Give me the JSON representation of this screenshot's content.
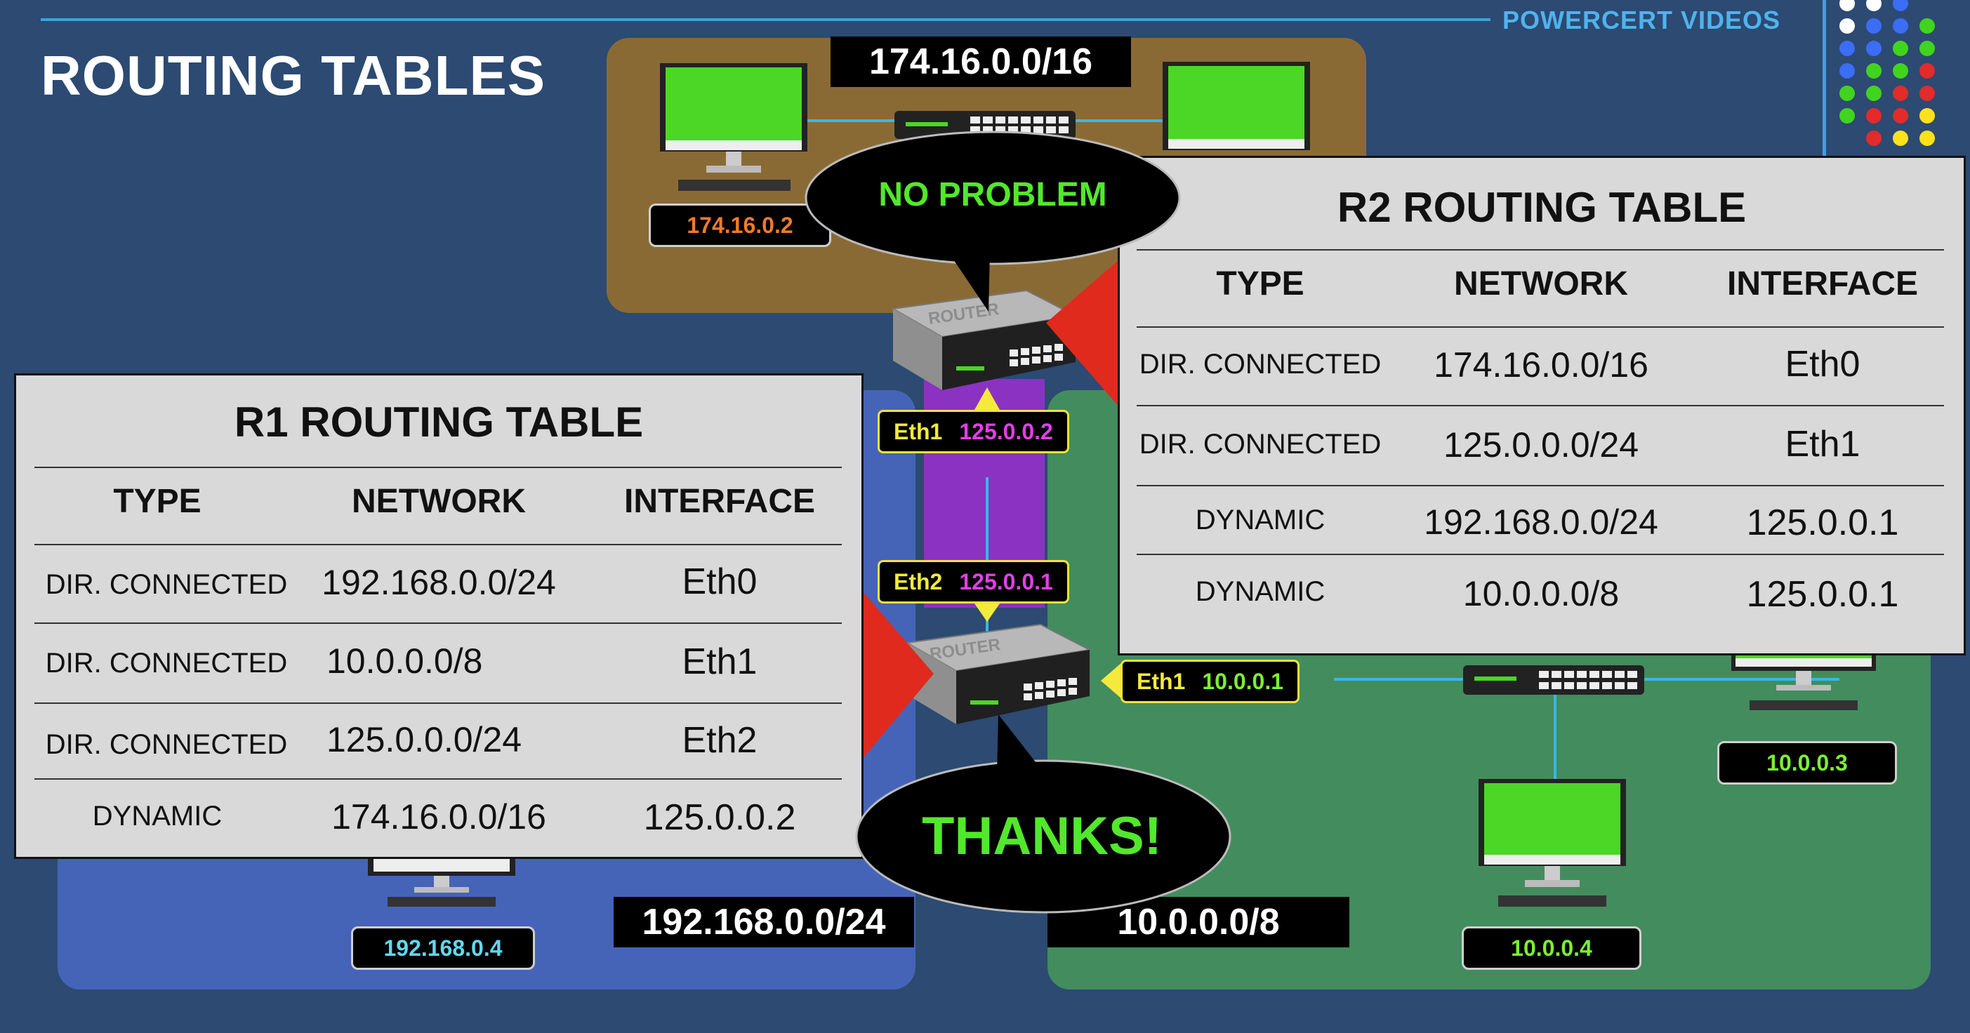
{
  "header": {
    "title": "ROUTING TABLES",
    "brand": "POWERCERT VIDEOS",
    "dot_colors": [
      "#ffffff",
      "#3b6df5",
      "#41d41f",
      "#e22b2b",
      "#ffe21c"
    ]
  },
  "networks": {
    "top": "174.16.0.0/16",
    "left": "192.168.0.0/24",
    "right": "10.0.0.0/8"
  },
  "hosts": {
    "top_host": "174.16.0.2",
    "left_host": "192.168.0.4",
    "right_host_a": "10.0.0.3",
    "right_host_b": "10.0.0.4"
  },
  "routers": {
    "r2_label": "ROUTER",
    "r1_label": "ROUTER",
    "r2_eth1_name": "Eth1",
    "r2_eth1_ip": "125.0.0.2",
    "r1_eth2_name": "Eth2",
    "r1_eth2_ip": "125.0.0.1",
    "r1_eth1_name": "Eth1",
    "r1_eth1_ip": "10.0.0.1"
  },
  "bubbles": {
    "top": "NO PROBLEM",
    "bottom": "THANKS!"
  },
  "r1_table": {
    "title": "R1 ROUTING TABLE",
    "headers": [
      "TYPE",
      "NETWORK",
      "INTERFACE"
    ],
    "rows": [
      [
        "DIR. CONNECTED",
        "192.168.0.0/24",
        "Eth0"
      ],
      [
        "DIR. CONNECTED",
        "10.0.0.0/8",
        "Eth1"
      ],
      [
        "DIR. CONNECTED",
        "125.0.0.0/24",
        "Eth2"
      ],
      [
        "DYNAMIC",
        "174.16.0.0/16",
        "125.0.0.2"
      ]
    ]
  },
  "r2_table": {
    "title": "R2 ROUTING TABLE",
    "headers": [
      "TYPE",
      "NETWORK",
      "INTERFACE"
    ],
    "rows": [
      [
        "DIR. CONNECTED",
        "174.16.0.0/16",
        "Eth0"
      ],
      [
        "DIR. CONNECTED",
        "125.0.0.0/24",
        "Eth1"
      ],
      [
        "DYNAMIC",
        "192.168.0.0/24",
        "125.0.0.1"
      ],
      [
        "DYNAMIC",
        "10.0.0.0/8",
        "125.0.0.1"
      ]
    ]
  },
  "colors": {
    "background": "#2c4a72",
    "zone_top": "#8a6a34",
    "zone_left": "#4564b8",
    "zone_right": "#438c5e",
    "link": "#8b32c2",
    "arrow_red": "#e02a1e",
    "bubble_text": "#52e82c"
  }
}
